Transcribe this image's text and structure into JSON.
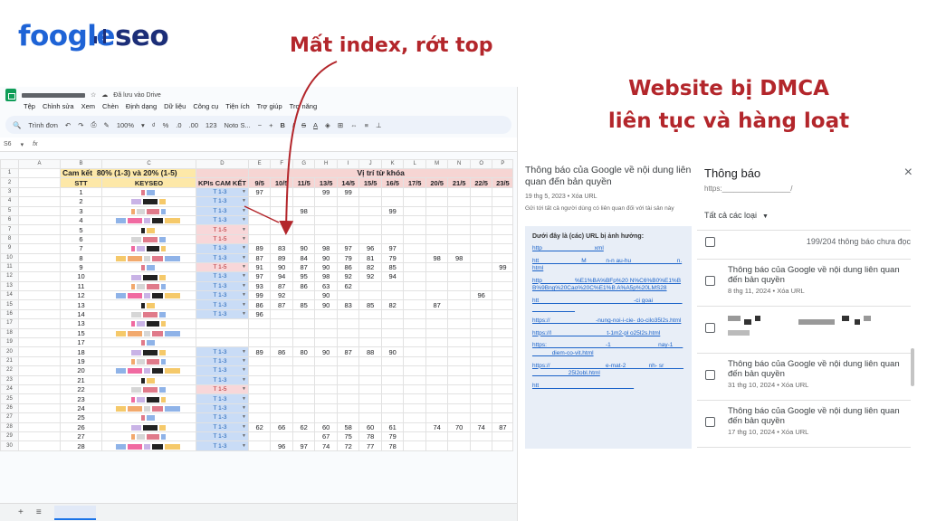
{
  "brand": {
    "name_part1": "foogle",
    "name_part2": "seo"
  },
  "headlines": {
    "index_loss": "Mất index, rớt top",
    "dmca_line1": "Website bị DMCA",
    "dmca_line2": "liên tục và hàng loạt"
  },
  "colors": {
    "accent_red": "#b3262b",
    "brand_blue": "#1e63d6",
    "brand_navy": "#1c2e78",
    "link_blue": "#1a62c9"
  },
  "spreadsheet": {
    "saved_status": "Đã lưu vào Drive",
    "menu": [
      "Tệp",
      "Chỉnh sửa",
      "Xem",
      "Chèn",
      "Định dạng",
      "Dữ liệu",
      "Công cụ",
      "Tiện ích",
      "Trợ giúp",
      "Trợ năng"
    ],
    "toolbar": {
      "search": "Trình đơn",
      "zoom": "100%",
      "font": "Noto S..."
    },
    "cell_ref": "S6",
    "fx": "fx",
    "col_letters": [
      "A",
      "B",
      "C",
      "D",
      "E",
      "F",
      "G",
      "H",
      "I",
      "J",
      "K",
      "L",
      "M",
      "N",
      "O",
      "P"
    ],
    "commit_label": "Cam kết",
    "commit_value": "80%  (1-3) và 20% (1-5)",
    "rank_header": "Vị trí từ khóa",
    "headers": {
      "stt": "STT",
      "keyword": "KEYSEO",
      "kpi": "KPIs CAM KẾT"
    },
    "dates": [
      "9/5",
      "10/5",
      "11/5",
      "13/5",
      "14/5",
      "15/5",
      "16/5",
      "17/5",
      "20/5",
      "21/5",
      "22/5",
      "23/5"
    ],
    "rows": [
      {
        "row": "3",
        "stt": "1",
        "kpi": "T 1-3",
        "kpi_alt": false,
        "v": [
          "97",
          "",
          "",
          "99",
          "99",
          "",
          "",
          "",
          "",
          "",
          "",
          ""
        ]
      },
      {
        "row": "4",
        "stt": "2",
        "kpi": "T 1-3",
        "kpi_alt": false,
        "v": [
          "",
          "",
          "",
          "",
          "",
          "",
          "",
          "",
          "",
          "",
          "",
          ""
        ]
      },
      {
        "row": "5",
        "stt": "3",
        "kpi": "T 1-3",
        "kpi_alt": false,
        "v": [
          "",
          "",
          "98",
          "",
          "",
          "",
          "99",
          "",
          "",
          "",
          "",
          ""
        ]
      },
      {
        "row": "6",
        "stt": "4",
        "kpi": "T 1-3",
        "kpi_alt": false,
        "v": [
          "",
          "",
          "",
          "",
          "",
          "",
          "",
          "",
          "",
          "",
          "",
          ""
        ]
      },
      {
        "row": "7",
        "stt": "5",
        "kpi": "T 1-5",
        "kpi_alt": true,
        "v": [
          "",
          "",
          "",
          "",
          "",
          "",
          "",
          "",
          "",
          "",
          "",
          ""
        ]
      },
      {
        "row": "8",
        "stt": "6",
        "kpi": "T 1-5",
        "kpi_alt": true,
        "v": [
          "",
          "",
          "",
          "",
          "",
          "",
          "",
          "",
          "",
          "",
          "",
          ""
        ]
      },
      {
        "row": "9",
        "stt": "7",
        "kpi": "T 1-3",
        "kpi_alt": false,
        "v": [
          "89",
          "83",
          "90",
          "98",
          "97",
          "96",
          "97",
          "",
          "",
          "",
          "",
          ""
        ]
      },
      {
        "row": "10",
        "stt": "8",
        "kpi": "T 1-3",
        "kpi_alt": false,
        "v": [
          "87",
          "89",
          "84",
          "90",
          "79",
          "81",
          "79",
          "",
          "98",
          "98",
          "",
          ""
        ]
      },
      {
        "row": "11",
        "stt": "9",
        "kpi": "T 1-5",
        "kpi_alt": true,
        "v": [
          "91",
          "90",
          "87",
          "90",
          "86",
          "82",
          "85",
          "",
          "",
          "",
          "",
          "99"
        ]
      },
      {
        "row": "12",
        "stt": "10",
        "kpi": "T 1-3",
        "kpi_alt": false,
        "v": [
          "97",
          "94",
          "95",
          "98",
          "92",
          "92",
          "94",
          "",
          "",
          "",
          "",
          ""
        ]
      },
      {
        "row": "13",
        "stt": "11",
        "kpi": "T 1-3",
        "kpi_alt": false,
        "v": [
          "93",
          "87",
          "86",
          "63",
          "62",
          "",
          "",
          "",
          "",
          "",
          "",
          ""
        ]
      },
      {
        "row": "14",
        "stt": "12",
        "kpi": "T 1-3",
        "kpi_alt": false,
        "v": [
          "99",
          "92",
          "",
          "90",
          "",
          "",
          "",
          "",
          "",
          "",
          "96",
          ""
        ]
      },
      {
        "row": "15",
        "stt": "13",
        "kpi": "T 1-3",
        "kpi_alt": false,
        "v": [
          "86",
          "87",
          "85",
          "90",
          "83",
          "85",
          "82",
          "",
          "87",
          "",
          "",
          ""
        ]
      },
      {
        "row": "16",
        "stt": "14",
        "kpi": "T 1-3",
        "kpi_alt": false,
        "v": [
          "96",
          "",
          "",
          "",
          "",
          "",
          "",
          "",
          "",
          "",
          "",
          ""
        ]
      },
      {
        "row": "17",
        "stt": "13",
        "kpi": "",
        "kpi_alt": false,
        "v": [
          "",
          "",
          "",
          "",
          "",
          "",
          "",
          "",
          "",
          "",
          "",
          ""
        ]
      },
      {
        "row": "18",
        "stt": "15",
        "kpi": "",
        "kpi_alt": false,
        "v": [
          "",
          "",
          "",
          "",
          "",
          "",
          "",
          "",
          "",
          "",
          "",
          ""
        ]
      },
      {
        "row": "19",
        "stt": "17",
        "kpi": "",
        "kpi_alt": false,
        "v": [
          "",
          "",
          "",
          "",
          "",
          "",
          "",
          "",
          "",
          "",
          "",
          ""
        ]
      },
      {
        "row": "20",
        "stt": "18",
        "kpi": "T 1-3",
        "kpi_alt": false,
        "v": [
          "89",
          "86",
          "80",
          "90",
          "87",
          "88",
          "90",
          "",
          "",
          "",
          "",
          ""
        ]
      },
      {
        "row": "21",
        "stt": "19",
        "kpi": "T 1-3",
        "kpi_alt": false,
        "v": [
          "",
          "",
          "",
          "",
          "",
          "",
          "",
          "",
          "",
          "",
          "",
          ""
        ]
      },
      {
        "row": "22",
        "stt": "20",
        "kpi": "T 1-3",
        "kpi_alt": false,
        "v": [
          "",
          "",
          "",
          "",
          "",
          "",
          "",
          "",
          "",
          "",
          "",
          ""
        ]
      },
      {
        "row": "23",
        "stt": "21",
        "kpi": "T 1-3",
        "kpi_alt": false,
        "v": [
          "",
          "",
          "",
          "",
          "",
          "",
          "",
          "",
          "",
          "",
          "",
          ""
        ]
      },
      {
        "row": "24",
        "stt": "22",
        "kpi": "T 1-5",
        "kpi_alt": true,
        "v": [
          "",
          "",
          "",
          "",
          "",
          "",
          "",
          "",
          "",
          "",
          "",
          ""
        ]
      },
      {
        "row": "25",
        "stt": "23",
        "kpi": "T 1-3",
        "kpi_alt": false,
        "v": [
          "",
          "",
          "",
          "",
          "",
          "",
          "",
          "",
          "",
          "",
          "",
          ""
        ]
      },
      {
        "row": "26",
        "stt": "24",
        "kpi": "T 1-3",
        "kpi_alt": false,
        "v": [
          "",
          "",
          "",
          "",
          "",
          "",
          "",
          "",
          "",
          "",
          "",
          ""
        ]
      },
      {
        "row": "27",
        "stt": "25",
        "kpi": "T 1-3",
        "kpi_alt": false,
        "v": [
          "",
          "",
          "",
          "",
          "",
          "",
          "",
          "",
          "",
          "",
          "",
          ""
        ]
      },
      {
        "row": "28",
        "stt": "26",
        "kpi": "T 1-3",
        "kpi_alt": false,
        "v": [
          "62",
          "66",
          "62",
          "60",
          "58",
          "60",
          "61",
          "",
          "74",
          "70",
          "74",
          "87"
        ]
      },
      {
        "row": "29",
        "stt": "27",
        "kpi": "T 1-3",
        "kpi_alt": false,
        "v": [
          "",
          "",
          "",
          "67",
          "75",
          "78",
          "79",
          "",
          "",
          "",
          "",
          ""
        ]
      },
      {
        "row": "30",
        "stt": "28",
        "kpi": "T 1-3",
        "kpi_alt": false,
        "v": [
          "",
          "96",
          "97",
          "74",
          "72",
          "77",
          "78",
          "",
          "",
          "",
          "",
          ""
        ]
      }
    ]
  },
  "email": {
    "title": "Thông báo của Google về nội dung liên quan đến bản quyền",
    "meta": "19 thg 5, 2023 • Xóa URL",
    "desc": "Gửi tới tất cả người dùng có liên quan đối với tài sản này",
    "box_title": "Dưới đây là (các) URL bị ảnh hưởng:",
    "urls": [
      "http________________xml",
      "htt_____________M______n-n au-hu______________n.html",
      "http__________%E1%BA%BFp%20 N%C6%B0%E1%BB%9Bng%20Cao%20C%E1%B A%A5p%20LMS28",
      "htt_____________________________-ci goai______________________",
      "https://______________-nung-noi-i-cie- do-cilo35l2s.html",
      "https://l_________________t-1m2-pl o25l2s.html",
      "https:__________________-1_______ _______nay-1_________diem-co-vit.html",
      "https://_________________e-mat-2_______nh- sr_________________25l2obl.html",
      "htt_____________________________"
    ]
  },
  "notifications": {
    "title": "Thông báo",
    "close": "×",
    "property": "https:_________________/",
    "filter": "Tất cả các loại",
    "unread": "199/204 thông báo chưa đọc",
    "items": [
      {
        "title": "Thông báo của Google về nội dung liên quan đến bản quyền",
        "meta": "8 thg 11, 2024 • Xóa URL"
      },
      {
        "title": "",
        "meta": ""
      },
      {
        "title": "Thông báo của Google về nội dung liên quan đến bản quyền",
        "meta": "31 thg 10, 2024 • Xóa URL"
      },
      {
        "title": "Thông báo của Google về nội dung liên quan đến bản quyền",
        "meta": "17 thg 10, 2024 • Xóa URL"
      }
    ]
  }
}
